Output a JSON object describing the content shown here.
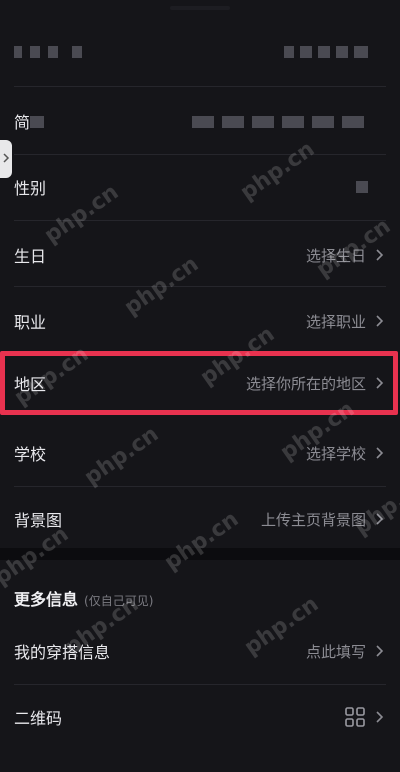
{
  "rows": {
    "bio": {
      "label": "简"
    },
    "gender": {
      "label": "性别"
    },
    "birthday": {
      "label": "生日",
      "value": "选择生日"
    },
    "job": {
      "label": "职业",
      "value": "选择职业"
    },
    "region": {
      "label": "地区",
      "value": "选择你所在的地区"
    },
    "school": {
      "label": "学校",
      "value": "选择学校"
    },
    "background": {
      "label": "背景图",
      "value": "上传主页背景图"
    },
    "outfit": {
      "label": "我的穿搭信息",
      "value": "点此填写"
    },
    "qrcode": {
      "label": "二维码"
    }
  },
  "more_info": {
    "title": "更多信息",
    "subtitle": "(仅自己可见)"
  },
  "watermark": "php.cn",
  "colors": {
    "highlight": "#e8324f",
    "background": "#151519"
  }
}
